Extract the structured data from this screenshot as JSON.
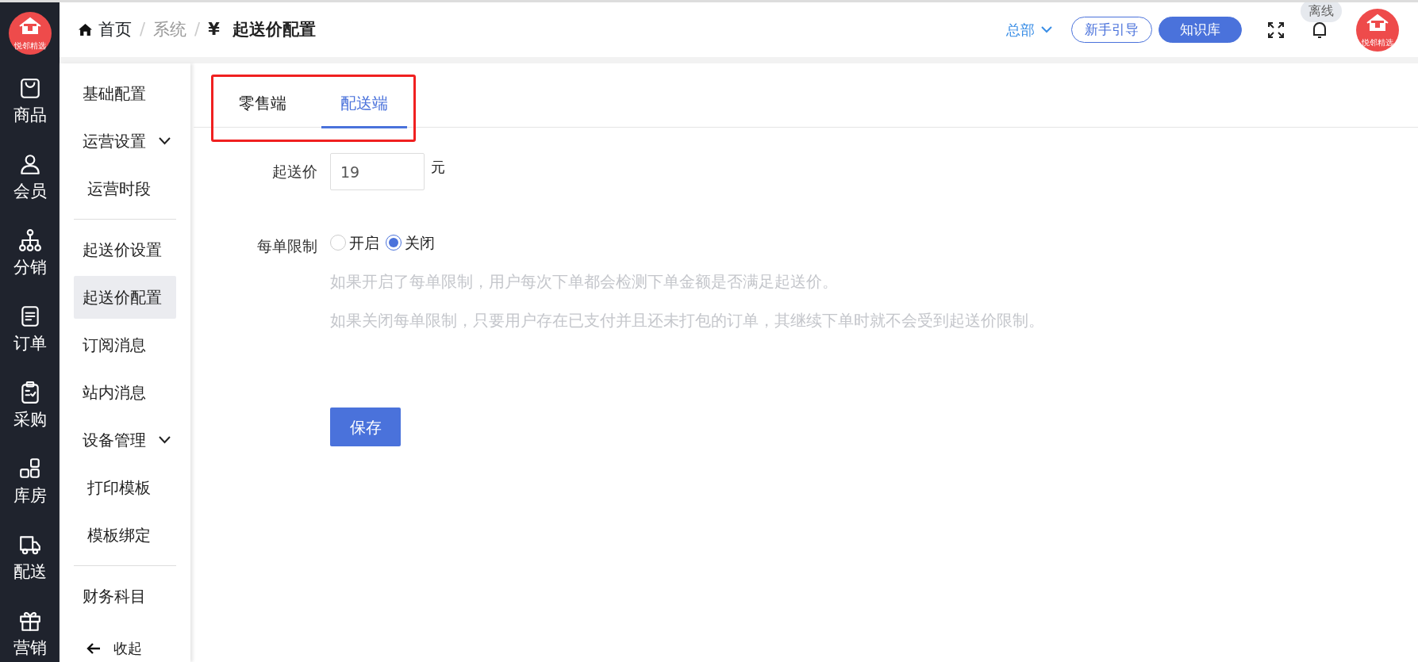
{
  "rail": {
    "logo_text": "悦邻精选",
    "items": [
      {
        "label": "商品"
      },
      {
        "label": "会员"
      },
      {
        "label": "分销"
      },
      {
        "label": "订单"
      },
      {
        "label": "采购"
      },
      {
        "label": "库房"
      },
      {
        "label": "配送"
      },
      {
        "label": "营销"
      }
    ]
  },
  "header": {
    "breadcrumb": [
      {
        "label": "首页",
        "kind": "home"
      },
      {
        "label": "系统",
        "kind": "plain",
        "separator": "/"
      },
      {
        "label": "起送价配置",
        "kind": "current",
        "icon_char": "¥",
        "separator": "/"
      }
    ],
    "region": "总部",
    "buttons": [
      {
        "label": "新手引导",
        "kind": "outline"
      },
      {
        "label": "知识库",
        "kind": "solid"
      }
    ],
    "status_badge": "离线",
    "avatar_logo_text": "悦邻精选"
  },
  "menu": {
    "sections": [
      [
        {
          "label": "基础配置",
          "selected": false
        },
        {
          "label": "运营设置",
          "selected": false,
          "expanded": true,
          "children": [
            {
              "label": "运营时段",
              "selected": false
            }
          ]
        }
      ],
      [
        {
          "label": "起送价设置",
          "selected": false
        },
        {
          "label": "起送价配置",
          "selected": true
        },
        {
          "label": "订阅消息",
          "selected": false
        },
        {
          "label": "站内消息",
          "selected": false
        },
        {
          "label": "设备管理",
          "selected": false,
          "expanded": true,
          "children": [
            {
              "label": "打印模板",
              "selected": false
            },
            {
              "label": "模板绑定",
              "selected": false
            }
          ]
        }
      ],
      [
        {
          "label": "财务科目",
          "selected": false
        }
      ]
    ],
    "collapse": "收起"
  },
  "tabs": [
    {
      "label": "零售端",
      "selected": false
    },
    {
      "label": "配送端",
      "selected": true
    }
  ],
  "form": {
    "min_price": {
      "label": "起送价",
      "value": "19",
      "unit": "元"
    },
    "per_order_limit": {
      "label": "每单限制",
      "options": [
        {
          "label": "开启",
          "selected": false
        },
        {
          "label": "关闭",
          "selected": true
        }
      ],
      "hints": [
        "如果开启了每单限制，用户每次下单都会检测下单金额是否满足起送价。",
        "如果关闭每单限制，只要用户存在已支付并且还未打包的订单，其继续下单时就不会受到起送价限制。"
      ]
    },
    "save": "保存"
  }
}
